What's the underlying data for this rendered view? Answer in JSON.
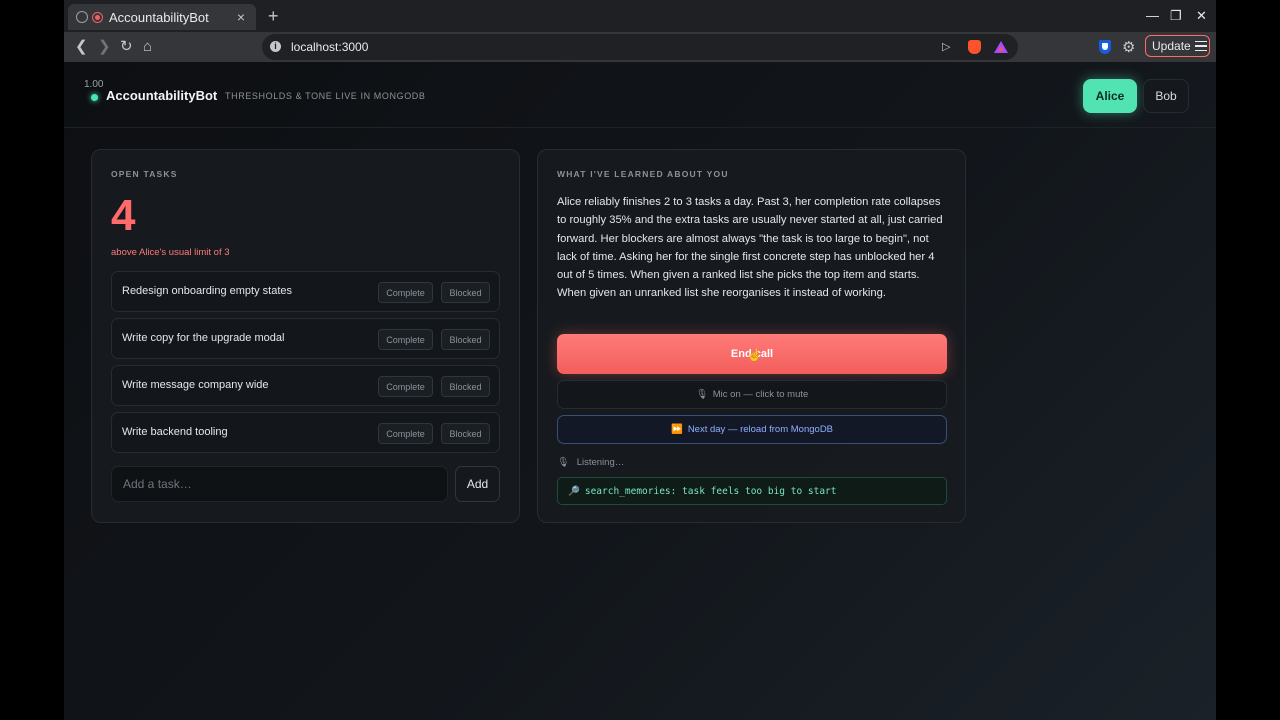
{
  "browser": {
    "tab_title": "AccountabilityBot",
    "url": "localhost:3000",
    "update_label": "Update",
    "new_tab": "+",
    "tab_close": "×",
    "minimize": "—",
    "maximize": "❐",
    "close": "✕"
  },
  "header": {
    "fps": "1.00",
    "brand": "AccountabilityBot",
    "tagline": "THRESHOLDS & TONE LIVE IN MONGODB",
    "users": [
      "Alice",
      "Bob"
    ],
    "active_user": "Alice"
  },
  "tasks": {
    "label": "OPEN TASKS",
    "count": "4",
    "limit_note": "above Alice's usual limit of 3",
    "items": [
      {
        "text": "Redesign onboarding empty states",
        "complete": "Complete",
        "blocked": "Blocked"
      },
      {
        "text": "Write copy for the upgrade modal",
        "complete": "Complete",
        "blocked": "Blocked"
      },
      {
        "text": "Write message company wide",
        "complete": "Complete",
        "blocked": "Blocked"
      },
      {
        "text": "Write backend tooling",
        "complete": "Complete",
        "blocked": "Blocked"
      }
    ],
    "add_placeholder": "Add a task…",
    "add_label": "Add"
  },
  "learned": {
    "label": "WHAT I'VE LEARNED ABOUT YOU",
    "text": "Alice reliably finishes 2 to 3 tasks a day. Past 3, her completion rate collapses to roughly 35% and the extra tasks are usually never started at all, just carried forward. Her blockers are almost always \"the task is too large to begin\", not lack of time. Asking her for the single first concrete step has unblocked her 4 out of 5 times. When given a ranked list she picks the top item and starts. When given an unranked list she reorganises it instead of working.",
    "end_call": "End call",
    "mic": "Mic on — click to mute",
    "next_day": "Next day — reload from MongoDB",
    "listening": "Listening…",
    "tool_log": "search_memories: task feels too big to start"
  },
  "colors": {
    "accent_green": "#52e3b3",
    "danger": "#ff6b6b",
    "info_blue": "#8fb0ff"
  }
}
